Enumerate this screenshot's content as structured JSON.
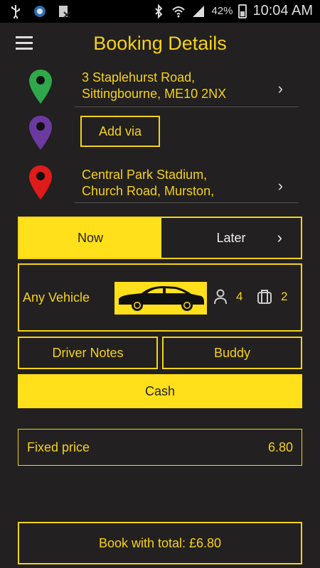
{
  "status_bar": {
    "battery": "42%",
    "time": "10:04 AM"
  },
  "header": {
    "title": "Booking Details"
  },
  "pickup": {
    "address": "3 Staplehurst Road,\nSittingbourne, ME10 2NX"
  },
  "via": {
    "label": "Add via"
  },
  "dropoff": {
    "address": "Central Park Stadium,\nChurch Road, Murston,"
  },
  "time_toggle": {
    "now": "Now",
    "later": "Later",
    "selected": "Now"
  },
  "vehicle": {
    "label": "Any Vehicle",
    "passengers": "4",
    "luggage": "2"
  },
  "options": {
    "driver_notes": "Driver Notes",
    "buddy": "Buddy"
  },
  "payment": {
    "method": "Cash"
  },
  "price": {
    "label": "Fixed price",
    "value": "6.80"
  },
  "book": {
    "label": "Book with total: £6.80"
  },
  "colors": {
    "accent": "#ffe01a",
    "background": "#222020",
    "pickup_pin": "#2ea84a",
    "via_pin": "#6b3aa0",
    "dropoff_pin": "#e01b1b"
  },
  "icons": [
    "usb-icon",
    "app-icon",
    "blocked-app-icon",
    "bluetooth-icon",
    "wifi-icon",
    "signal-icon",
    "battery-icon",
    "menu-icon",
    "pickup-pin-icon",
    "via-pin-icon",
    "dropoff-pin-icon",
    "chevron-right-icon",
    "car-icon",
    "person-icon",
    "luggage-icon"
  ]
}
